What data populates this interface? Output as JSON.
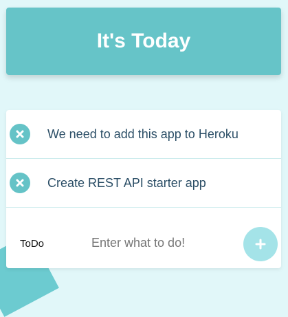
{
  "header": {
    "title": "It's Today"
  },
  "todos": [
    {
      "text": "We need to add this app to Heroku",
      "remove_icon": "close-icon"
    },
    {
      "text": "Create REST API starter app",
      "remove_icon": "close-icon"
    }
  ],
  "composer": {
    "label": "ToDo",
    "placeholder": "Enter what to do!",
    "value": "",
    "add_icon": "plus-icon"
  },
  "colors": {
    "accent": "#66c4c8",
    "page_background": "#e1f7f9",
    "add_button": "#a4e3e8",
    "item_text": "#2b4e66"
  }
}
